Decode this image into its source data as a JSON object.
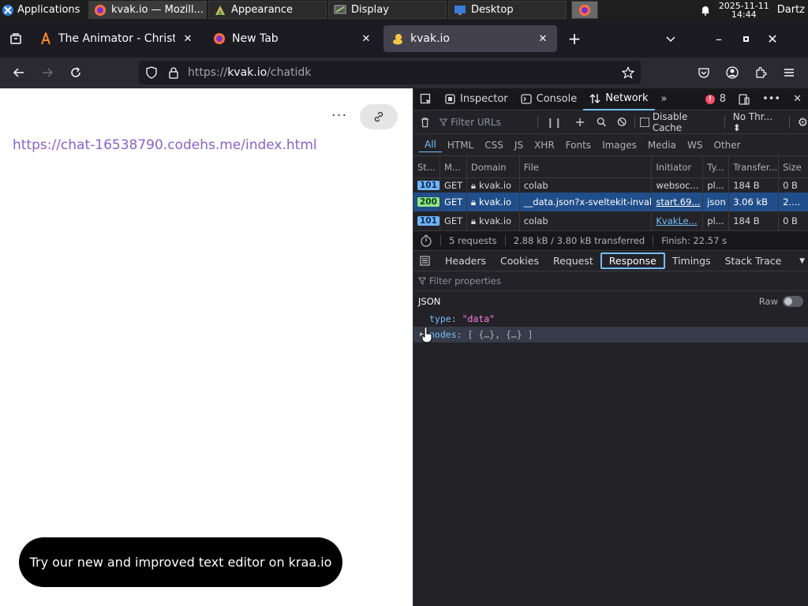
{
  "taskbar": {
    "apps_label": "Applications",
    "tasks": [
      {
        "label": "kvak.io — Mozill...",
        "icon": "firefox-icon"
      },
      {
        "label": "Appearance",
        "icon": "appearance-icon"
      },
      {
        "label": "Display",
        "icon": "display-icon"
      },
      {
        "label": "Desktop",
        "icon": "desktop-icon"
      }
    ],
    "clock_date": "2025-11-11",
    "clock_time": "14:44",
    "user": "Dartz"
  },
  "browser": {
    "tabs": [
      {
        "title": "The Animator - Christmas",
        "icon": "animator-icon"
      },
      {
        "title": "New Tab",
        "icon": "firefox-icon"
      },
      {
        "title": "kvak.io",
        "icon": "duck-icon"
      }
    ],
    "url_prefix": "https://",
    "url_host": "kvak.io",
    "url_path": "/chatidk"
  },
  "page": {
    "link_text": "https://chat-16538790.codehs.me/index.html",
    "more_label": "···",
    "toast_text": "Try our new and improved text editor on kraa.io"
  },
  "devtools": {
    "tabs": {
      "inspector": "Inspector",
      "console": "Console",
      "network": "Network"
    },
    "error_count": "8",
    "filter_urls_placeholder": "Filter URLs",
    "disable_cache_label": "Disable Cache",
    "throttle_label": "No Thr...",
    "type_filters": [
      "All",
      "HTML",
      "CSS",
      "JS",
      "XHR",
      "Fonts",
      "Images",
      "Media",
      "WS",
      "Other"
    ],
    "columns": [
      "St...",
      "M...",
      "Domain",
      "File",
      "Initiator",
      "Ty...",
      "Transfer...",
      "Size"
    ],
    "requests": [
      {
        "status": "101",
        "method": "GET",
        "domain": "kvak.io",
        "file": "colab",
        "initiator": "websoc...",
        "type": "pl...",
        "transferred": "184 B",
        "size": "0 B"
      },
      {
        "status": "200",
        "method": "GET",
        "domain": "kvak.io",
        "file": "__data.json?x-sveltekit-invalid",
        "initiator": "start.69...",
        "type": "json",
        "transferred": "3.06 kB",
        "size": "2...."
      },
      {
        "status": "101",
        "method": "GET",
        "domain": "kvak.io",
        "file": "colab",
        "initiator": "KvakLe...",
        "type": "pl...",
        "transferred": "184 B",
        "size": "0 B"
      }
    ],
    "summary": {
      "requests": "5 requests",
      "transferred": "2.88 kB / 3.80 kB transferred",
      "finish": "Finish: 22.57 s"
    },
    "detail_tabs": [
      "Headers",
      "Cookies",
      "Request",
      "Response",
      "Timings",
      "Stack Trace"
    ],
    "filter_props_placeholder": "Filter properties",
    "json_label": "JSON",
    "raw_label": "Raw",
    "json_type_key": "type",
    "json_type_val": "\"data\"",
    "json_nodes_key": "nodes",
    "json_nodes_val": "[ {…}, {…} ]"
  },
  "colors": {
    "accent": "#75bfff",
    "link": "#8b61c9",
    "selected_row": "#204e8a"
  }
}
